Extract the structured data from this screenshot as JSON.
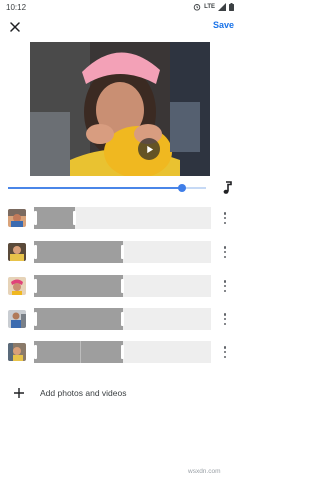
{
  "status_bar": {
    "time": "10:12",
    "network": "LTE",
    "icons": [
      "alarm-icon",
      "wifi-icon",
      "signal-icon",
      "battery-icon"
    ]
  },
  "toolbar": {
    "close_icon": "close-icon",
    "save_label": "Save"
  },
  "player": {
    "play_icon": "play-icon",
    "progress": 0.88
  },
  "soundtrack": {
    "icon": "music-note-icon"
  },
  "clips": [
    {
      "name": "clip-1",
      "range_start": 0.0,
      "range_end": 0.23,
      "divider": null
    },
    {
      "name": "clip-2",
      "range_start": 0.0,
      "range_end": 0.5,
      "divider": null
    },
    {
      "name": "clip-3",
      "range_start": 0.0,
      "range_end": 0.5,
      "divider": null
    },
    {
      "name": "clip-4",
      "range_start": 0.0,
      "range_end": 0.5,
      "divider": null
    },
    {
      "name": "clip-5",
      "range_start": 0.0,
      "range_end": 0.5,
      "divider": 0.26
    }
  ],
  "add_media": {
    "icon": "plus-icon",
    "label": "Add photos and videos"
  },
  "watermark": "wsxdn.com",
  "colors": {
    "accent": "#1a73e8",
    "track_bg": "#eeeeee",
    "range_fill": "#9e9e9e",
    "progress": "#4a86e8"
  }
}
